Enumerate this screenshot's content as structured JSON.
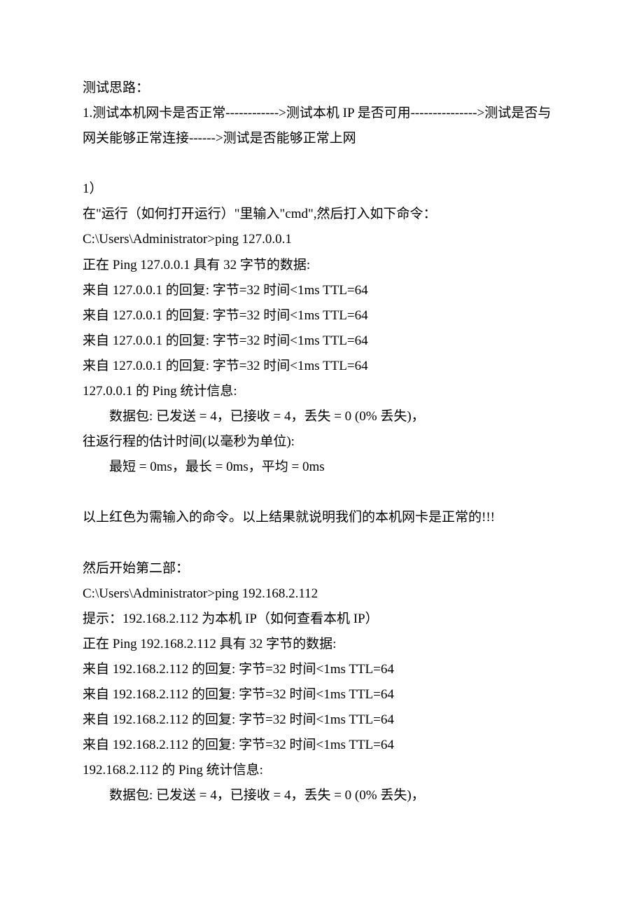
{
  "lines": {
    "l1": "测试思路：",
    "l2": "1.测试本机网卡是否正常------------>测试本机 IP 是否可用--------------->测试是否与网关能够正常连接------>测试是否能够正常上网",
    "l3": "1）",
    "l4": "在\"运行（如何打开运行）\"里输入\"cmd\",然后打入如下命令：",
    "l5": "C:\\Users\\Administrator>ping 127.0.0.1",
    "l6": "正在 Ping 127.0.0.1 具有 32 字节的数据:",
    "l7": "来自 127.0.0.1 的回复: 字节=32 时间<1ms TTL=64",
    "l8": "来自 127.0.0.1 的回复: 字节=32 时间<1ms TTL=64",
    "l9": "来自 127.0.0.1 的回复: 字节=32 时间<1ms TTL=64",
    "l10": "来自 127.0.0.1 的回复: 字节=32 时间<1ms TTL=64",
    "l11": "127.0.0.1 的 Ping 统计信息:",
    "l12": "数据包: 已发送 = 4，已接收 = 4，丢失 = 0 (0% 丢失)，",
    "l13": "往返行程的估计时间(以毫秒为单位):",
    "l14": "最短 = 0ms，最长 = 0ms，平均 = 0ms",
    "l15": "以上红色为需输入的命令。以上结果就说明我们的本机网卡是正常的!!!",
    "l16": "然后开始第二部：",
    "l17": "C:\\Users\\Administrator>ping 192.168.2.112",
    "l18": "提示：192.168.2.112 为本机 IP（如何查看本机 IP）",
    "l19": "正在 Ping 192.168.2.112 具有 32 字节的数据:",
    "l20": "来自 192.168.2.112 的回复: 字节=32 时间<1ms TTL=64",
    "l21": "来自 192.168.2.112 的回复: 字节=32 时间<1ms TTL=64",
    "l22": "来自 192.168.2.112 的回复: 字节=32 时间<1ms TTL=64",
    "l23": "来自 192.168.2.112 的回复: 字节=32 时间<1ms TTL=64",
    "l24": "192.168.2.112 的 Ping 统计信息:",
    "l25": "数据包: 已发送 = 4，已接收 = 4，丢失 = 0 (0% 丢失)，"
  }
}
